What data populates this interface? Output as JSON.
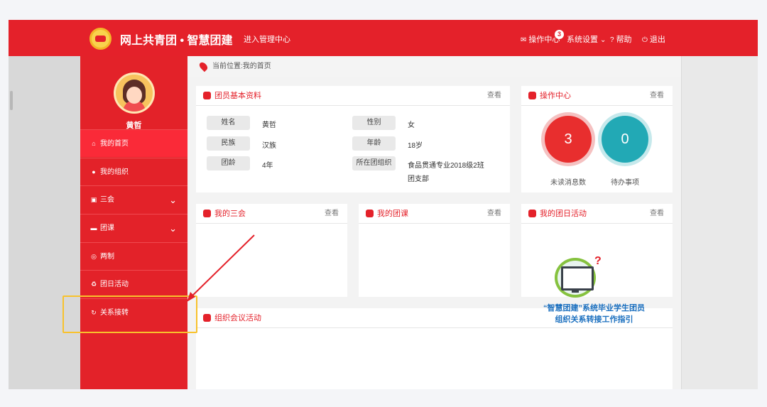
{
  "topbar": {
    "site_title": "网上共青团 • 智慧团建",
    "admin_link": "进入管理中心",
    "ops_center": "操作中心",
    "ops_badge": "3",
    "system_settings": "系统设置",
    "help": "帮助",
    "exit": "退出"
  },
  "sidebar": {
    "user_name": "黄哲",
    "items": [
      {
        "label": "我的首页",
        "icon": "home-icon"
      },
      {
        "label": "我的组织",
        "icon": "group-icon"
      },
      {
        "label": "三会",
        "icon": "edit-icon"
      },
      {
        "label": "团课",
        "icon": "folder-icon"
      },
      {
        "label": "两制",
        "icon": "target-icon"
      },
      {
        "label": "团日活动",
        "icon": "recycle-icon"
      },
      {
        "label": "关系接转",
        "icon": "refresh-icon"
      }
    ]
  },
  "breadcrumb": "当前位置:我的首页",
  "profile": {
    "title": "团员基本资料",
    "more": "查看",
    "rows": [
      {
        "label": "姓名",
        "value": "黄哲"
      },
      {
        "label": "性别",
        "value": "女"
      },
      {
        "label": "民族",
        "value": "汉族"
      },
      {
        "label": "年龄",
        "value": "18岁"
      },
      {
        "label": "团龄",
        "value": "4年"
      },
      {
        "label": "所在团组织",
        "value": "食品贯通专业2018级2班",
        "value2": "团支部"
      }
    ]
  },
  "ops": {
    "title": "操作中心",
    "more": "查看",
    "unread_count": "3",
    "unread_label": "未读消息数",
    "todo_count": "0",
    "todo_label": "待办事项"
  },
  "sanhui": {
    "title": "我的三会",
    "more": "查看"
  },
  "tuanke": {
    "title": "我的团课",
    "more": "查看"
  },
  "tuanri": {
    "title": "我的团日活动",
    "more": "查看"
  },
  "meeting": {
    "title": "组织会议活动"
  },
  "promo": {
    "line1": "“智慧团建”系统毕业学生团员",
    "line2": "组织关系转接工作指引"
  },
  "colors": {
    "brand_red": "#e4212a",
    "active_nav": "#fa2a38",
    "teal": "#22a9b5",
    "annotation_yellow": "#f8c22c"
  }
}
